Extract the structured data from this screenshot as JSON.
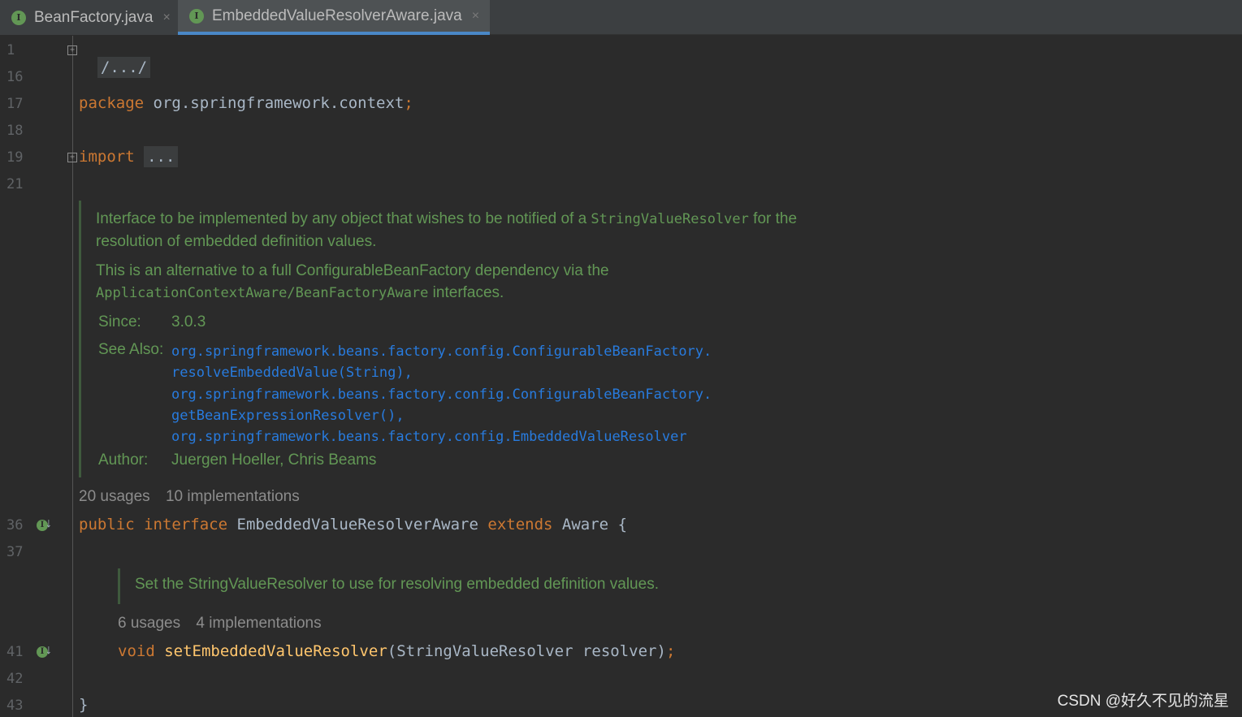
{
  "tabs": [
    {
      "label": "BeanFactory.java",
      "icon": "interface-icon",
      "close": "×"
    },
    {
      "label": "EmbeddedValueResolverAware.java",
      "icon": "interface-icon",
      "close": "×"
    }
  ],
  "line_numbers": [
    "1",
    "16",
    "17",
    "18",
    "19",
    "21",
    "36",
    "37",
    "41",
    "42",
    "43"
  ],
  "code": {
    "line1_fold": "/.../",
    "package_kw": "package",
    "package_name": " org.springframework.context",
    "semicolon": ";",
    "import_kw": "import",
    "import_fold": "...",
    "public_kw": "public",
    "interface_kw": "interface",
    "class_name": "EmbeddedValueResolverAware",
    "extends_kw": "extends",
    "parent": "Aware",
    "open_brace": "{",
    "void_kw": "void",
    "method_name": "setEmbeddedValueResolver",
    "method_params": "(StringValueResolver resolver)",
    "close_brace": "}"
  },
  "doc1": {
    "p1_a": "Interface to be implemented by any object that wishes to be notified of a ",
    "p1_code": "StringValueResolver",
    "p1_b": " for the",
    "p1_c": "resolution of embedded definition values.",
    "p2_a": "This is an alternative to a full ConfigurableBeanFactory dependency via the",
    "p2_code": "ApplicationContextAware/BeanFactoryAware",
    "p2_b": " interfaces.",
    "since_label": "Since:",
    "since_value": "3.0.3",
    "see_label": "See Also:",
    "see_links": [
      "org.springframework.beans.factory.config.ConfigurableBeanFactory.",
      "resolveEmbeddedValue(String),",
      "org.springframework.beans.factory.config.ConfigurableBeanFactory.",
      "getBeanExpressionResolver(),",
      "org.springframework.beans.factory.config.EmbeddedValueResolver"
    ],
    "author_label": "Author:",
    "author_value": "Juergen Hoeller, Chris Beams"
  },
  "hints1": {
    "usages": "20 usages",
    "impls": "10 implementations"
  },
  "doc2": {
    "text": "Set the StringValueResolver to use for resolving embedded definition values."
  },
  "hints2": {
    "usages": "6 usages",
    "impls": "4 implementations"
  },
  "gutter_icon_letter": "I",
  "gutter_arrow": "↓",
  "fold_symbol": "+",
  "watermark": "CSDN @好久不见的流星"
}
